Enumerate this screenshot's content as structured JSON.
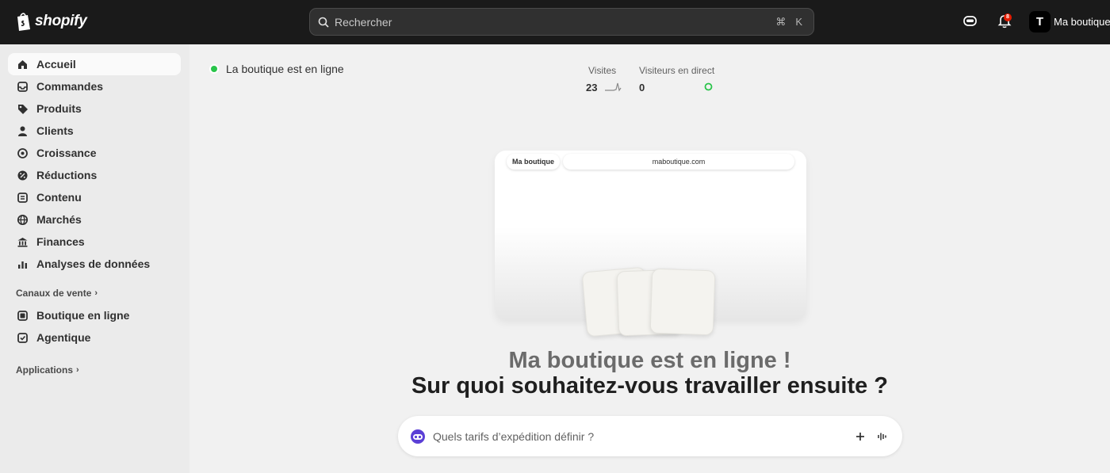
{
  "topbar": {
    "logo_text": "shopify",
    "search_placeholder": "Rechercher",
    "shortcut_cmd": "⌘",
    "shortcut_key": "K",
    "notification_count": "8",
    "avatar_initial": "T",
    "store_name": "Ma boutique"
  },
  "sidebar": {
    "items": [
      {
        "label": "Accueil",
        "icon": "home-icon"
      },
      {
        "label": "Commandes",
        "icon": "inbox-icon"
      },
      {
        "label": "Produits",
        "icon": "tag-icon"
      },
      {
        "label": "Clients",
        "icon": "person-icon"
      },
      {
        "label": "Croissance",
        "icon": "target-icon"
      },
      {
        "label": "Réductions",
        "icon": "discount-icon"
      },
      {
        "label": "Contenu",
        "icon": "content-icon"
      },
      {
        "label": "Marchés",
        "icon": "globe-icon"
      },
      {
        "label": "Finances",
        "icon": "bank-icon"
      },
      {
        "label": "Analyses de données",
        "icon": "chart-bars-icon"
      }
    ],
    "sales_channels_title": "Canaux de vente",
    "channels": [
      {
        "label": "Boutique en ligne",
        "icon": "storefront-icon"
      },
      {
        "label": "Agentique",
        "icon": "agentic-icon"
      }
    ],
    "apps_title": "Applications"
  },
  "main": {
    "status_text": "La boutique est en ligne",
    "visits_label": "Visites",
    "visits_value": "23",
    "live_label": "Visiteurs en direct",
    "live_value": "0",
    "preview_tab": "Ma boutique",
    "preview_url": "maboutique.com",
    "headline_1": "Ma boutique est en ligne !",
    "headline_2": "Sur quoi souhaitez-vous travailler ensuite ?",
    "prompt_placeholder": "Quels tarifs d’expédition définir ?"
  },
  "colors": {
    "topbar_bg": "#1a1a1a",
    "sidebar_bg": "#ebebeb",
    "main_bg": "#f1f1f1",
    "status_green": "#29c44a",
    "badge_red": "#e51c00"
  }
}
